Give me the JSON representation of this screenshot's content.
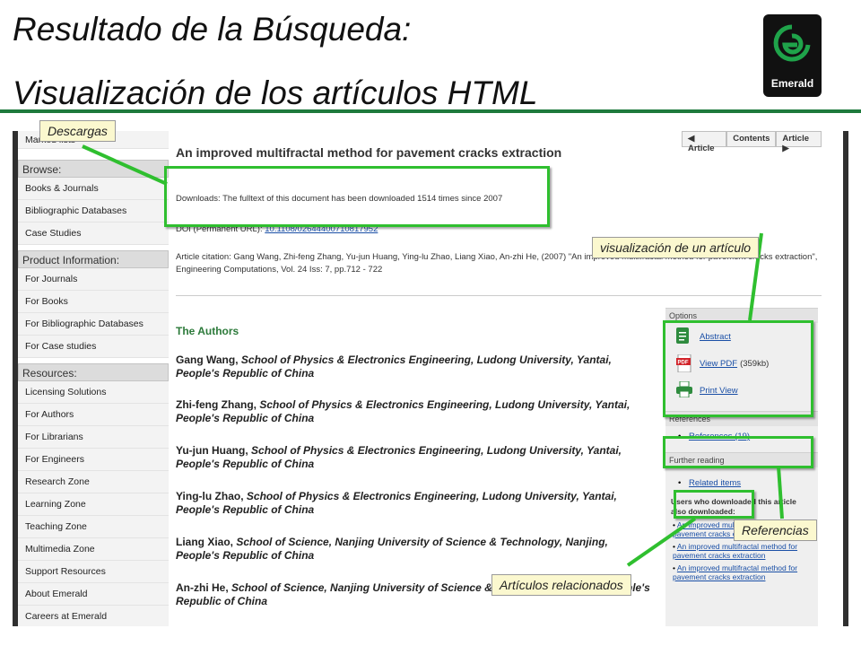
{
  "slide": {
    "title_line1": "Resultado de la Búsqueda:",
    "title_line2": "Visualización de los artículos HTML",
    "logo_text": "Emerald",
    "accent_color": "#1e7a3c",
    "highlight_color": "#2fbf2f"
  },
  "callouts": {
    "descargas": "Descargas",
    "visualizacion": "visualización de un artículo",
    "referencias": "Referencias",
    "relacionados": "Artículos relacionados"
  },
  "leftnav": {
    "top_item": "Marked lists",
    "groups": [
      {
        "heading": "Browse:",
        "items": [
          "Books & Journals",
          "Bibliographic Databases",
          "Case Studies"
        ]
      },
      {
        "heading": "Product Information:",
        "items": [
          "For Journals",
          "For Books",
          "For Bibliographic Databases",
          "For Case studies"
        ]
      },
      {
        "heading": "Resources:",
        "items": [
          "Licensing Solutions",
          "For Authors",
          "For Librarians",
          "For Engineers",
          "Research Zone",
          "Learning Zone",
          "Teaching Zone",
          "Multimedia Zone",
          "Support Resources",
          "About Emerald",
          "Careers at Emerald"
        ]
      }
    ]
  },
  "main": {
    "tabs": [
      "Article",
      "Contents",
      "Article"
    ],
    "title": "An improved multifractal method for pavement cracks extraction",
    "downloads": "Downloads: The fulltext of this document has been downloaded 1514 times since 2007",
    "doi_label": "DOI (Permanent URL):",
    "doi_link": "10.1108/02644400710817952",
    "citation": "Article citation: Gang Wang, Zhi-feng Zhang, Yu-jun Huang, Ying-lu Zhao, Liang Xiao, An-zhi He, (2007) \"An improved multifractal method for pavement cracks extraction\", Engineering Computations, Vol. 24 Iss: 7, pp.712 - 722",
    "authors_heading": "The Authors",
    "authors": [
      {
        "name": "Gang Wang,",
        "affiliation": "School of Physics & Electronics Engineering, Ludong University, Yantai, People's Republic of China"
      },
      {
        "name": "Zhi-feng Zhang,",
        "affiliation": "School of Physics & Electronics Engineering, Ludong University, Yantai, People's Republic of China"
      },
      {
        "name": "Yu-jun Huang,",
        "affiliation": "School of Physics & Electronics Engineering, Ludong University, Yantai, People's Republic of China"
      },
      {
        "name": "Ying-lu Zhao,",
        "affiliation": "School of Physics & Electronics Engineering, Ludong University, Yantai, People's Republic of China"
      },
      {
        "name": "Liang Xiao,",
        "affiliation": "School of Science, Nanjing University of Science & Technology, Nanjing, People's Republic of China"
      },
      {
        "name": "An-zhi He,",
        "affiliation": "School of Science, Nanjing University of Science & Technology, Nanjing, People's Republic of China"
      }
    ]
  },
  "sidebar": {
    "options_heading": "Options",
    "abstract": "Abstract",
    "view_pdf": "View PDF",
    "pdf_size": "(359kb)",
    "print_view": "Print View",
    "references_heading": "References",
    "references_link": "References (19)",
    "further_heading": "Further reading",
    "related_link": "Related items",
    "users_text": "Users who downloaded this article also downloaded:",
    "user_links": [
      "An improved multifractal method for pavement cracks extraction",
      "An improved multifractal method for pavement cracks extraction",
      "An improved multifractal method for pavement cracks extraction"
    ]
  }
}
